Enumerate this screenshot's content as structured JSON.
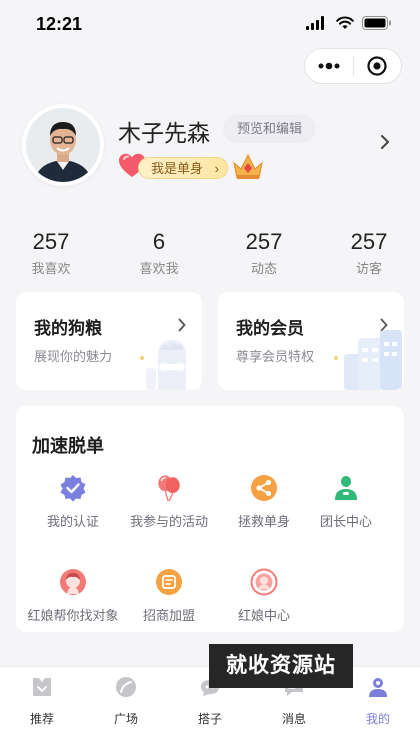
{
  "status_bar": {
    "time": "12:21"
  },
  "profile": {
    "name": "木子先森",
    "edit_label": "预览和编辑",
    "single_tag": "我是单身",
    "single_tag_chevron": "›"
  },
  "stats": [
    {
      "value": "257",
      "label": "我喜欢"
    },
    {
      "value": "6",
      "label": "喜欢我"
    },
    {
      "value": "257",
      "label": "动态"
    },
    {
      "value": "257",
      "label": "访客"
    }
  ],
  "cards": {
    "dog_food": {
      "title": "我的狗粮",
      "subtitle": "展现你的魅力"
    },
    "membership": {
      "title": "我的会员",
      "subtitle": "尊享会员特权"
    }
  },
  "speed_section": {
    "title": "加速脱单",
    "items": [
      {
        "label": "我的认证",
        "icon": "verified-badge-icon",
        "color": "#7b7fe0"
      },
      {
        "label": "我参与的活动",
        "icon": "balloons-icon",
        "color": "#f47a78"
      },
      {
        "label": "拯救单身",
        "icon": "share-icon",
        "color": "#f6a243"
      },
      {
        "label": "团长中心",
        "icon": "leader-icon",
        "color": "#2fba7a"
      },
      {
        "label": "红娘帮你找对象",
        "icon": "matchmaker-icon",
        "color": "#f47a78"
      },
      {
        "label": "招商加盟",
        "icon": "franchise-icon",
        "color": "#f6a243"
      },
      {
        "label": "红娘中心",
        "icon": "matchmaker-center-icon",
        "color": "#f47a78"
      }
    ]
  },
  "tabbar": {
    "tabs": [
      {
        "label": "推荐",
        "icon": "recommend-icon"
      },
      {
        "label": "广场",
        "icon": "square-icon"
      },
      {
        "label": "搭子",
        "icon": "buddy-icon"
      },
      {
        "label": "消息",
        "icon": "message-icon"
      },
      {
        "label": "我的",
        "icon": "profile-icon",
        "active": true
      }
    ]
  },
  "watermark": "就收资源站",
  "colors": {
    "accent": "#7b7fd9",
    "background": "#f5f5f7"
  }
}
